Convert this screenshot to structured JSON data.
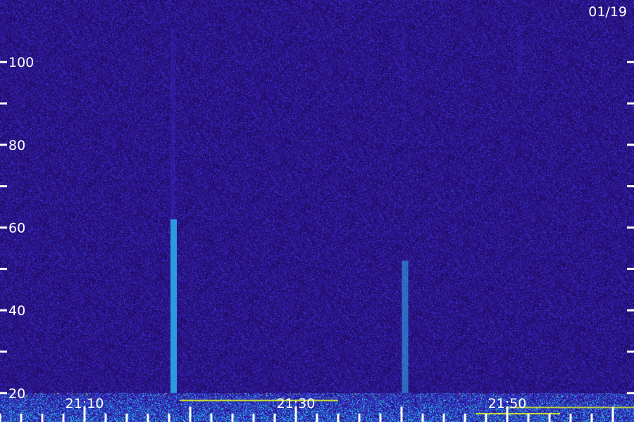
{
  "chart_data": {
    "type": "heatmap",
    "title": "",
    "date_label": "01/19",
    "xlabel": "",
    "ylabel": "",
    "ylim": [
      13,
      115
    ],
    "xlim": [
      "21:02",
      "21:62"
    ],
    "y_ticks": [
      {
        "value": 100,
        "label": "100"
      },
      {
        "value": 90,
        "label": ""
      },
      {
        "value": 80,
        "label": "80"
      },
      {
        "value": 70,
        "label": ""
      },
      {
        "value": 60,
        "label": "60"
      },
      {
        "value": 50,
        "label": ""
      },
      {
        "value": 40,
        "label": "40"
      },
      {
        "value": 30,
        "label": ""
      },
      {
        "value": 20,
        "label": "20"
      },
      {
        "value": 10,
        "label": ""
      }
    ],
    "x_ticks": [
      {
        "minute": 2,
        "label": ""
      },
      {
        "minute": 4,
        "label": ""
      },
      {
        "minute": 6,
        "label": ""
      },
      {
        "minute": 8,
        "label": ""
      },
      {
        "minute": 10,
        "label": "21:10"
      },
      {
        "minute": 12,
        "label": ""
      },
      {
        "minute": 14,
        "label": ""
      },
      {
        "minute": 16,
        "label": ""
      },
      {
        "minute": 18,
        "label": ""
      },
      {
        "minute": 20,
        "label": ""
      },
      {
        "minute": 22,
        "label": ""
      },
      {
        "minute": 24,
        "label": ""
      },
      {
        "minute": 26,
        "label": ""
      },
      {
        "minute": 28,
        "label": ""
      },
      {
        "minute": 30,
        "label": "21:30"
      },
      {
        "minute": 32,
        "label": ""
      },
      {
        "minute": 34,
        "label": ""
      },
      {
        "minute": 36,
        "label": ""
      },
      {
        "minute": 38,
        "label": ""
      },
      {
        "minute": 40,
        "label": ""
      },
      {
        "minute": 42,
        "label": ""
      },
      {
        "minute": 44,
        "label": ""
      },
      {
        "minute": 46,
        "label": ""
      },
      {
        "minute": 48,
        "label": ""
      },
      {
        "minute": 50,
        "label": "21:50"
      },
      {
        "minute": 52,
        "label": ""
      },
      {
        "minute": 54,
        "label": ""
      },
      {
        "minute": 56,
        "label": ""
      },
      {
        "minute": 58,
        "label": ""
      },
      {
        "minute": 60,
        "label": ""
      }
    ],
    "major_x_minutes": [
      10,
      20,
      30,
      40,
      50,
      60
    ],
    "noise_floor_y": 20,
    "features": [
      {
        "kind": "meteor-trail",
        "minute": 18.4,
        "y_from": 20,
        "y_to": 62,
        "intensity": 0.9
      },
      {
        "kind": "meteor-trail",
        "minute": 40.3,
        "y_from": 20,
        "y_to": 52,
        "intensity": 0.6
      },
      {
        "kind": "faint-trail",
        "minute": 18.4,
        "y_from": 62,
        "y_to": 108,
        "intensity": 0.25
      },
      {
        "kind": "faint-trail",
        "minute": 40.3,
        "y_from": 80,
        "y_to": 108,
        "intensity": 0.15
      },
      {
        "kind": "faint-trail",
        "minute": 51.2,
        "y_from": 96,
        "y_to": 109,
        "intensity": 0.2
      },
      {
        "kind": "horizontal-carrier",
        "minute_from": 2,
        "minute_to": 12,
        "y": 53.5,
        "intensity": 0.25
      },
      {
        "kind": "horizontal-carrier",
        "minute_from": 19,
        "minute_to": 34,
        "y": 18.2,
        "intensity": 0.9
      },
      {
        "kind": "horizontal-carrier",
        "minute_from": 47,
        "minute_to": 55,
        "y": 15.0,
        "intensity": 1.0
      },
      {
        "kind": "horizontal-carrier",
        "minute_from": 50,
        "minute_to": 62,
        "y": 16.5,
        "intensity": 0.8
      }
    ],
    "colors": {
      "background": "#2a0f8a",
      "low": "#1c0a5c",
      "mid": "#3b2fd6",
      "high": "#2fa8e8",
      "peak": "#d8f020",
      "axis": "#ffffff"
    }
  }
}
